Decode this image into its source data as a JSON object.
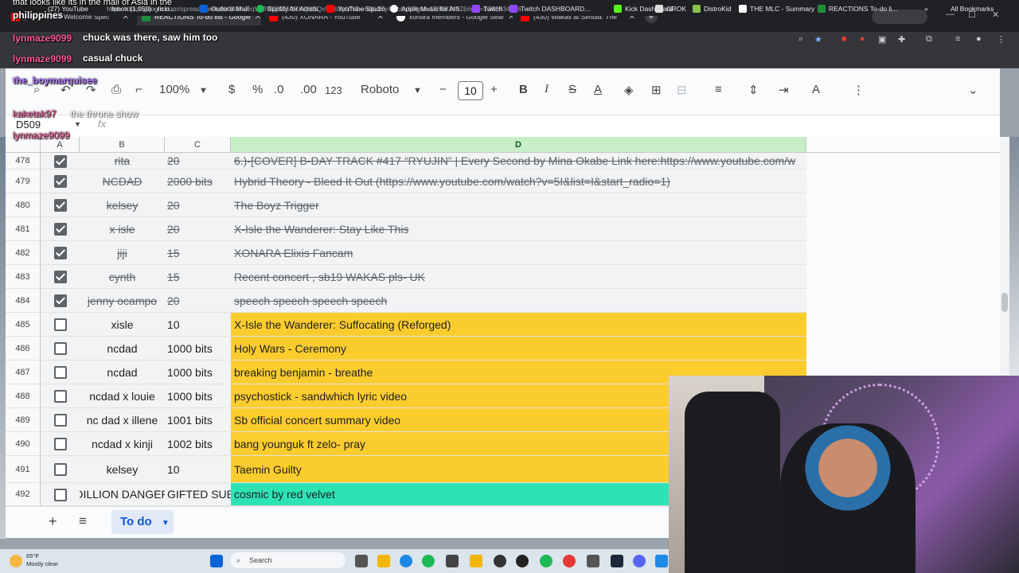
{
  "browser": {
    "tabs": [
      {
        "label": "(430) #SB19 Welcome Spec",
        "active": false
      },
      {
        "label": "REACTIONS To-do list - Google",
        "active": true
      },
      {
        "label": "(430) XONARA - YouTube",
        "active": false
      },
      {
        "label": "xonara members - Google Sear",
        "active": false
      },
      {
        "label": "(430) Wakas at Simula: The",
        "active": false
      }
    ],
    "url": "https://docs.google.com/spreadsheets/d/1lWnJ6qWOWQS154RKQdSQx97lb3yNfW-e6qjL27y4vlc/edit?gid=1386834576#gid=1386834576",
    "bookmarks": [
      "(27) YouTube",
      "Inbox (1,050) - ricki...",
      "Outlook Mail",
      "Spotify for Artists",
      "YouTube Studio",
      "Apple Music for Arti...",
      "Twitch",
      "Twitch DASHBOARD...",
      "Kick Dashboard",
      "GROK",
      "DistroKid",
      "THE MLC - Summary",
      "REACTIONS To-do li...",
      "All Bookmarks"
    ]
  },
  "toolbar": {
    "zoom": "100%",
    "currency": "$",
    "percent": "%",
    "dec_less": ".0",
    "dec_more": ".00",
    "number_format": "123",
    "font": "Roboto",
    "font_size": "10",
    "bold": "B",
    "italic": "I",
    "strike": "S",
    "text_color": "A"
  },
  "formula_bar": {
    "name_box": "D509",
    "fx": "fx"
  },
  "columns": [
    "A",
    "B",
    "C",
    "D"
  ],
  "rows": [
    {
      "num": "478",
      "checked": true,
      "b": "rita",
      "c": "20",
      "d": "6.)-[COVER] B-DAY TRACK #417 “RYUJIN” | Every Second by Mina Okabe Link here:https://www.youtube.com/w",
      "fill": ""
    },
    {
      "num": "479",
      "checked": true,
      "b": "NCDAD",
      "c": "2000 bits",
      "d": "Hybrid Theory - Bleed It Out (https://www.youtube.com/watch?v=5I&list=I&start_radio=1)",
      "fill": ""
    },
    {
      "num": "480",
      "checked": true,
      "b": "kelsey",
      "c": "20",
      "d": "The Boyz Trigger",
      "fill": ""
    },
    {
      "num": "481",
      "checked": true,
      "b": "x isle",
      "c": "20",
      "d": "X-Isle the Wanderer: Stay Like This",
      "fill": ""
    },
    {
      "num": "482",
      "checked": true,
      "b": "jiji",
      "c": "15",
      "d": "XONARA Elixis Fancam",
      "fill": ""
    },
    {
      "num": "483",
      "checked": true,
      "b": "cynth",
      "c": "15",
      "d": "Recent concert , sb19 WAKAS pls- UK",
      "fill": ""
    },
    {
      "num": "484",
      "checked": true,
      "b": "jenny ocampo",
      "c": "20",
      "d": "speech speech speech speech",
      "fill": ""
    },
    {
      "num": "485",
      "checked": false,
      "b": "xisle",
      "c": "10",
      "d": "X-Isle the Wanderer: Suffocating (Reforged)",
      "fill": "#fbcc2e"
    },
    {
      "num": "486",
      "checked": false,
      "b": "ncdad",
      "c": "1000 bits",
      "d": "Holy Wars - Ceremony",
      "fill": "#fbcc2e"
    },
    {
      "num": "487",
      "checked": false,
      "b": "ncdad",
      "c": "1000 bits",
      "d": "breaking benjamin - breathe",
      "fill": "#fbcc2e"
    },
    {
      "num": "488",
      "checked": false,
      "b": "ncdad x louie",
      "c": "1000 bits",
      "d": "psychostick - sandwhich lyric video",
      "fill": "#fbcc2e"
    },
    {
      "num": "489",
      "checked": false,
      "b": "nc dad x illene",
      "c": "1001 bits",
      "d": "Sb official concert summary video",
      "fill": "#fbcc2e"
    },
    {
      "num": "490",
      "checked": false,
      "b": "ncdad x kinji",
      "c": "1002 bits",
      "d": "bang younguk ft zelo- pray",
      "fill": "#fbcc2e"
    },
    {
      "num": "491",
      "checked": false,
      "b": "kelsey",
      "c": "10",
      "d": "Taemin Guilty",
      "fill": "#fbcc2e"
    },
    {
      "num": "492",
      "checked": false,
      "b": "DILLION DANGER",
      "c": "GIFTED SUB",
      "d": "cosmic by red velvet",
      "fill": "#2de3b4"
    }
  ],
  "sheet_tab": "To do",
  "chat": [
    {
      "user": "philippines",
      "text": "",
      "color": "#ffffff",
      "pre": "that looks like its in the mall of Asia in the"
    },
    {
      "user": "lynmaze9099",
      "text": "chuck was there, saw him too",
      "color": "#ff5aa0"
    },
    {
      "user": "lynmaze9099",
      "text": "casual chuck",
      "color": "#ff5aa0"
    },
    {
      "user": "the_boymarquisee",
      "text": "",
      "color": "#b57cff"
    },
    {
      "user": "kaketak97",
      "text": "the throne show",
      "color": "#ff5aa0"
    },
    {
      "user": "lynmaze9099",
      "text": "",
      "color": "#ff5aa0"
    }
  ],
  "taskbar": {
    "temp": "65°F",
    "weather": "Mostly clear",
    "search": "Search"
  }
}
